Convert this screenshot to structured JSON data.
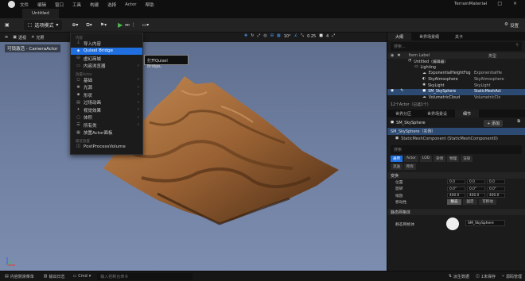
{
  "menubar": {
    "items": [
      "文件",
      "编辑",
      "窗口",
      "工具",
      "构建",
      "选择",
      "Actor",
      "帮助"
    ],
    "project_name": "TerrainMaterial",
    "window_controls": "– □ ×"
  },
  "tab": {
    "title": "Untitled"
  },
  "toolbar": {
    "mode_label": "选项模式",
    "settings_label": "设置"
  },
  "viewport_toolbar": {
    "perspective": "透视",
    "lit": "光照",
    "snap_angle": "10°",
    "snap_scale": "0.25",
    "camera_speed": "4"
  },
  "viewport": {
    "label": "可锁激活 - CameraActor"
  },
  "dropdown": {
    "header_content": "内容",
    "items_top": [
      {
        "label": "导入内容",
        "icon": "import-icon"
      },
      {
        "label": "Quixel Bridge",
        "icon": "bridge-icon",
        "highlighted": true
      },
      {
        "label": "虚幻商城",
        "icon": "marketplace-icon"
      },
      {
        "label": "内容浏览器",
        "icon": "folder-icon",
        "submenu": true
      }
    ],
    "header_place": "放置Actor",
    "items_place": [
      {
        "label": "基础",
        "submenu": true
      },
      {
        "label": "光源",
        "submenu": true
      },
      {
        "label": "形状",
        "submenu": true
      },
      {
        "label": "过场动画",
        "submenu": true
      },
      {
        "label": "视觉效果",
        "submenu": true
      },
      {
        "label": "体积",
        "submenu": true
      },
      {
        "label": "所有类",
        "submenu": true
      },
      {
        "label": "放置Actor面板"
      }
    ],
    "header_recent": "最近放置",
    "items_recent": [
      {
        "label": "PostProcessVolume"
      }
    ]
  },
  "tooltip": {
    "text": "打开Quixel Bridge。"
  },
  "outliner": {
    "tabs": [
      "大纲",
      "世界场景纲",
      "关卡"
    ],
    "search_placeholder": "搜索...",
    "col_label": "Item Label",
    "col_type": "类型",
    "rows": [
      {
        "label": "Untitled（编辑器）",
        "type": "",
        "indent": 1
      },
      {
        "label": "Lighting",
        "type": "",
        "indent": 2
      },
      {
        "label": "ExponentialHeightFog",
        "type": "ExponentialHe",
        "indent": 3
      },
      {
        "label": "SkyAtmosphere",
        "type": "SkyAtmosphere",
        "indent": 3
      },
      {
        "label": "SkyLight",
        "type": "SkyLight",
        "indent": 3
      },
      {
        "label": "SM_SkySphere",
        "type": "StaticMeshAct",
        "indent": 3,
        "selected": true
      },
      {
        "label": "VolumetricCloud",
        "type": "VolumetricClo",
        "indent": 3
      }
    ],
    "count_text": "12个Actor（已选1个）"
  },
  "details": {
    "tabs": [
      "世界分区",
      "世界场景设",
      "细节"
    ],
    "actor_name": "SM_SkySphere",
    "add_label": "+ 添加",
    "components": [
      {
        "label": "SM_SkySphere（实例）",
        "selected": true
      },
      {
        "label": "StaticMeshComponent (StaticMeshComponent0)"
      }
    ],
    "search_placeholder": "搜索",
    "categories": [
      "通用",
      "Actor",
      "LOD",
      "杂项",
      "物理",
      "渲染",
      "流送",
      "所有"
    ],
    "section_transform": "变换",
    "transform": [
      {
        "label": "位置",
        "x": "0.0",
        "y": "0.0",
        "z": "0.0"
      },
      {
        "label": "旋转",
        "x": "0.0°",
        "y": "0.0°",
        "z": "0.0°"
      },
      {
        "label": "缩放",
        "x": "400.0",
        "y": "400.0",
        "z": "400.0"
      }
    ],
    "mobility_label": "移动性",
    "mobility": [
      "静态",
      "固定",
      "可移动"
    ],
    "section_mesh": "静态网格体",
    "mesh_label": "静态网格体",
    "mesh_value": "SM_SkySphere"
  },
  "bottombar": {
    "content_drawer": "内容侧滑菜单",
    "output_log": "输出日志",
    "cmd": "Cmd",
    "cmd_placeholder": "输入控制台命令",
    "derived_data": "派生数据",
    "unsaved": "1未保存",
    "source_control": "源码管理"
  },
  "colors": {
    "accent": "#1f6fe0",
    "selection": "#2c4a72",
    "play": "#4fb84f",
    "sky": "#6e7ea0",
    "sand": "#a0683a"
  }
}
